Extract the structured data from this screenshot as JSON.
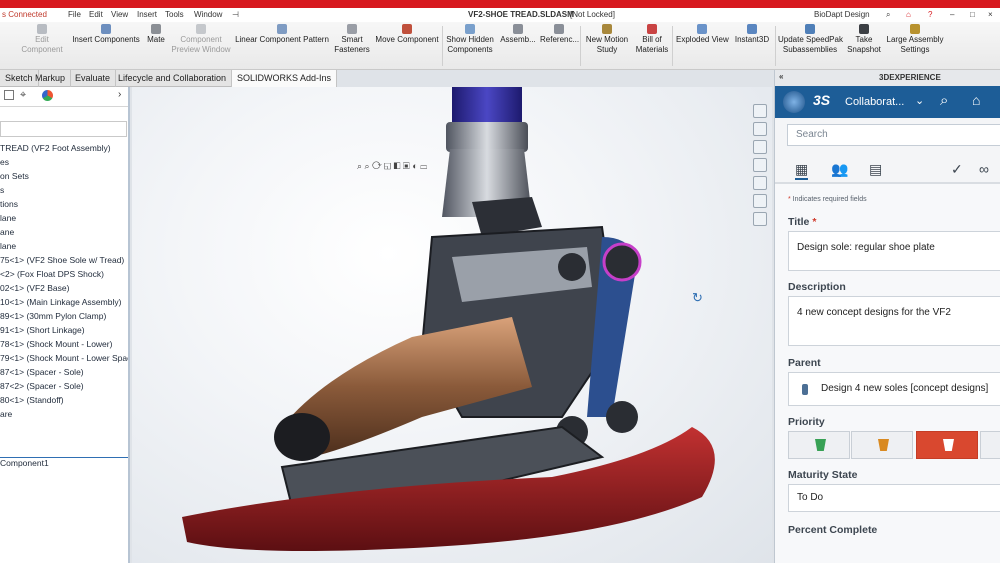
{
  "menubar": {
    "status": "s Connected",
    "items": [
      "File",
      "Edit",
      "View",
      "Insert",
      "Tools",
      "Window"
    ],
    "pin": "⊣",
    "doc_title": "VF2-SHOE TREAD.SLDASM",
    "doc_state": "[Not Locked]",
    "user": "BioDapt Design"
  },
  "ribbon": {
    "buttons": [
      {
        "label": "Edit\nComponent",
        "disabled": true
      },
      {
        "label": "Insert Components",
        "disabled": false
      },
      {
        "label": "Mate",
        "disabled": false
      },
      {
        "label": "Component\nPreview Window",
        "disabled": true
      },
      {
        "label": "Linear Component Pattern",
        "disabled": false
      },
      {
        "label": "Smart\nFasteners",
        "disabled": false
      },
      {
        "label": "Move Component",
        "disabled": false
      },
      {
        "label": "Show Hidden\nComponents",
        "disabled": false
      },
      {
        "label": "Assemb...",
        "disabled": false
      },
      {
        "label": "Referenc...",
        "disabled": false
      },
      {
        "label": "New Motion\nStudy",
        "disabled": false
      },
      {
        "label": "Bill of\nMaterials",
        "disabled": false
      },
      {
        "label": "Exploded View",
        "disabled": false
      },
      {
        "label": "Instant3D",
        "disabled": false
      },
      {
        "label": "Update SpeedPak\nSubassemblies",
        "disabled": false
      },
      {
        "label": "Take\nSnapshot",
        "disabled": false
      },
      {
        "label": "Large Assembly\nSettings",
        "disabled": false
      }
    ]
  },
  "tabs": [
    "Sketch",
    "Markup",
    "Evaluate",
    "Lifecycle and Collaboration",
    "SOLIDWORKS Add-Ins"
  ],
  "tree": {
    "items": [
      "TREAD (VF2 Foot Assembly)",
      "es",
      "on Sets",
      "s",
      "tions",
      "lane",
      "ane",
      "lane",
      "75<1> (VF2 Shoe Sole w/ Tread)",
      "<2> (Fox Float DPS Shock)",
      "02<1> (VF2 Base)",
      "10<1> (Main Linkage Assembly)",
      "89<1> (30mm Pylon Clamp)",
      "91<1> (Short Linkage)",
      "78<1> (Shock Mount - Lower)",
      "79<1> (Shock Mount - Lower Spac",
      "87<1> (Spacer - Sole)",
      "87<2> (Spacer - Sole)",
      "80<1> (Standoff)",
      "are"
    ],
    "bottom": "Component1"
  },
  "panel": {
    "top_title": "3DEXPERIENCE",
    "collapse": "«",
    "app_name": "Collaborat...",
    "search_placeholder": "Search",
    "required_note": "Indicates required fields",
    "title_label": "Title",
    "title_value": "Design sole: regular shoe plate",
    "description_label": "Description",
    "description_value": "4 new concept designs for the VF2",
    "parent_label": "Parent",
    "parent_value": "Design 4 new soles [concept designs]",
    "priority_label": "Priority",
    "priority_selected": 2,
    "maturity_label": "Maturity State",
    "maturity_value": "To Do",
    "percent_label": "Percent Complete"
  },
  "colors": {
    "brand_red": "#d7191f",
    "panel_header": "#1d5d97",
    "priority_high": "#d9482f",
    "priority_low": "#37a155",
    "priority_medium": "#d98a21"
  }
}
